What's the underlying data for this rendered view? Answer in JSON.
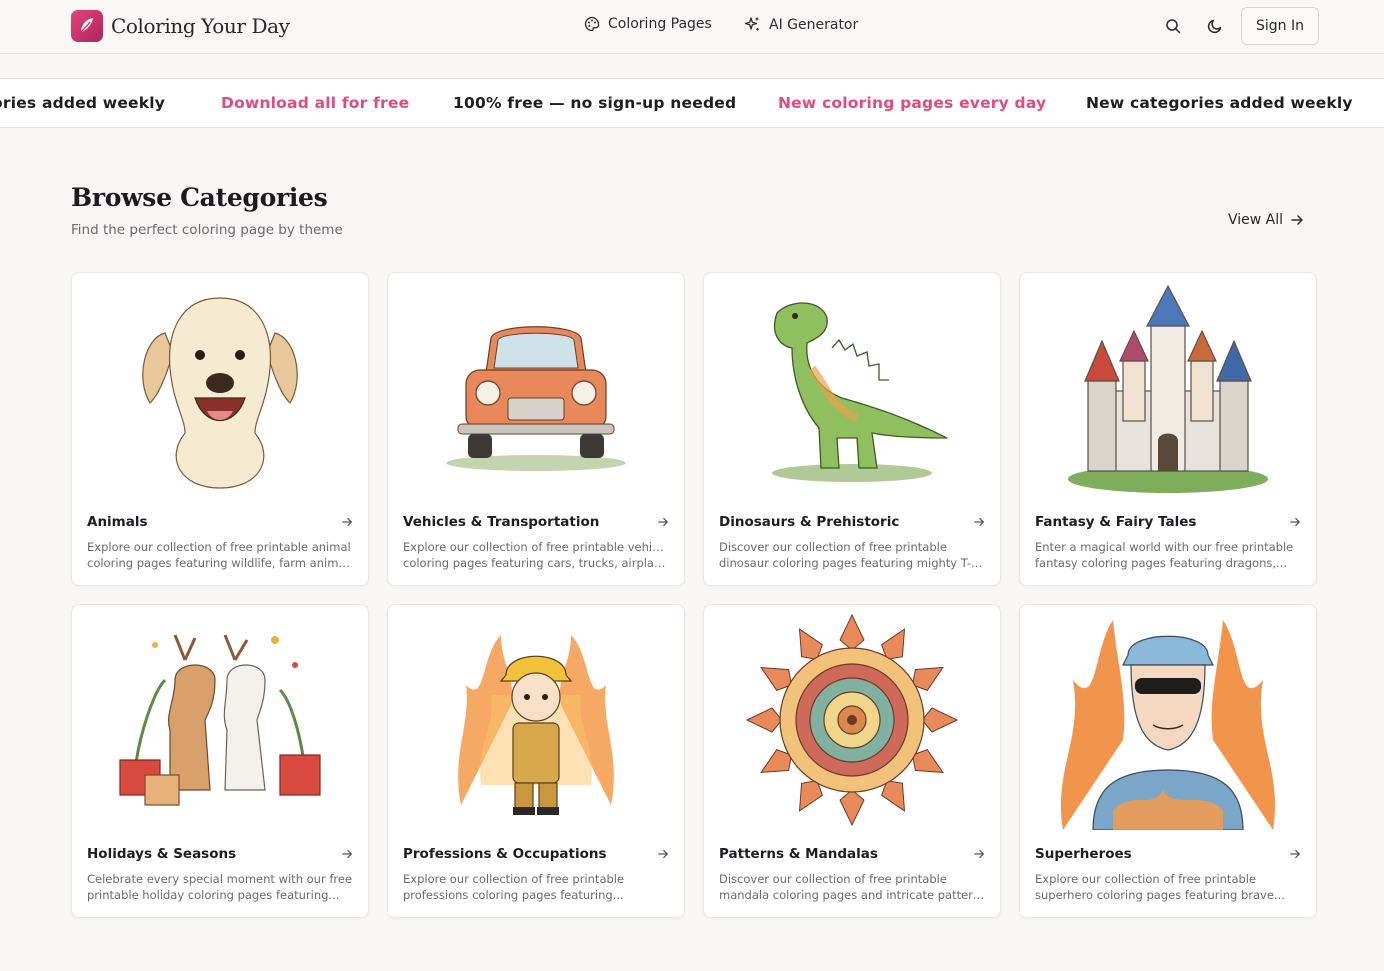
{
  "header": {
    "brand": "Coloring Your Day",
    "nav": [
      {
        "label": "Coloring Pages",
        "icon": "palette-icon"
      },
      {
        "label": "AI Generator",
        "icon": "sparkles-icon"
      }
    ],
    "sign_in_label": "Sign In"
  },
  "ticker": [
    {
      "text": "ories added weekly",
      "style": "dark"
    },
    {
      "text": "Download all for free",
      "style": "pink"
    },
    {
      "text": "100% free — no sign-up needed",
      "style": "dark"
    },
    {
      "text": "New coloring pages every day",
      "style": "pink"
    },
    {
      "text": "New categories added weekly",
      "style": "dark"
    }
  ],
  "section": {
    "title": "Browse Categories",
    "subtitle": "Find the perfect coloring page by theme",
    "view_all_label": "View All"
  },
  "categories": [
    {
      "title": "Animals",
      "desc_line1": "Explore our collection of free printable animal",
      "desc_line2": "coloring pages featuring wildlife, farm animals,...",
      "image": "dog-illustration"
    },
    {
      "title": "Vehicles & Transportation",
      "desc_line1": "Explore our collection of free printable vehicles",
      "desc_line2": "coloring pages featuring cars, trucks, airplanes...",
      "image": "car-illustration"
    },
    {
      "title": "Dinosaurs & Prehistoric",
      "desc_line1": "Discover our collection of free printable",
      "desc_line2": "dinosaur coloring pages featuring mighty T-Re...",
      "image": "dinosaur-illustration"
    },
    {
      "title": "Fantasy & Fairy Tales",
      "desc_line1": "Enter a magical world with our free printable",
      "desc_line2": "fantasy coloring pages featuring dragons,...",
      "image": "castle-illustration"
    },
    {
      "title": "Holidays & Seasons",
      "desc_line1": "Celebrate every special moment with our free",
      "desc_line2": "printable holiday coloring pages featuring...",
      "image": "reindeer-illustration"
    },
    {
      "title": "Professions & Occupations",
      "desc_line1": "Explore our collection of free printable",
      "desc_line2": "professions coloring pages featuring...",
      "image": "firefighter-illustration"
    },
    {
      "title": "Patterns & Mandalas",
      "desc_line1": "Discover our collection of free printable",
      "desc_line2": "mandala coloring pages and intricate pattern...",
      "image": "mandala-illustration"
    },
    {
      "title": "Superheroes",
      "desc_line1": "Explore our collection of free printable",
      "desc_line2": "superhero coloring pages featuring brave...",
      "image": "superhero-illustration"
    }
  ],
  "colors": {
    "accent": "#e24b7e",
    "background": "#f8f7f5"
  }
}
